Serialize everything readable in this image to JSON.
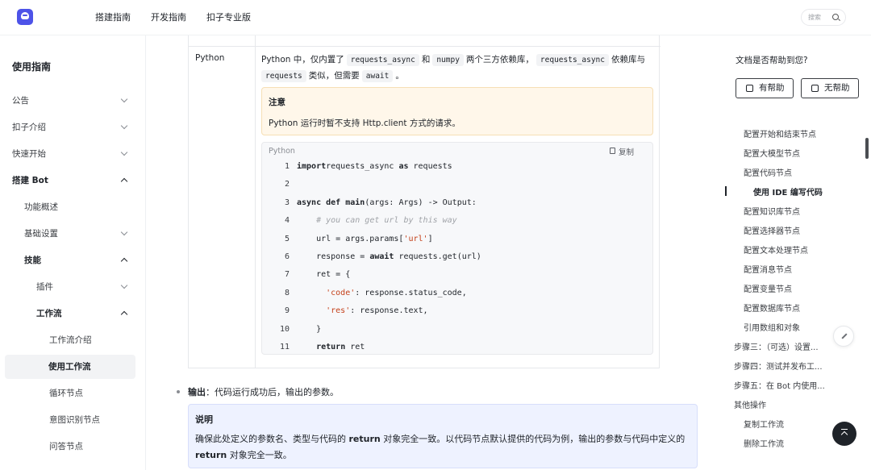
{
  "header": {
    "nav": [
      "搭建指南",
      "开发指南",
      "扣子专业版"
    ],
    "search_placeholder": "搜索"
  },
  "sidebar": {
    "title": "使用指南",
    "items": [
      {
        "label": "公告",
        "state": "collapsed"
      },
      {
        "label": "扣子介绍",
        "state": "collapsed"
      },
      {
        "label": "快速开始",
        "state": "collapsed"
      },
      {
        "label": "搭建 Bot",
        "state": "expanded"
      },
      {
        "label": "功能概述",
        "state": "none"
      },
      {
        "label": "基础设置",
        "state": "collapsed"
      },
      {
        "label": "技能",
        "state": "expanded"
      },
      {
        "label": "插件",
        "state": "collapsed"
      },
      {
        "label": "工作流",
        "state": "expanded"
      },
      {
        "label": "工作流介绍",
        "state": "none"
      },
      {
        "label": "使用工作流",
        "state": "active"
      },
      {
        "label": "循环节点",
        "state": "none"
      },
      {
        "label": "意图识别节点",
        "state": "none"
      },
      {
        "label": "问答节点",
        "state": "none"
      }
    ]
  },
  "main": {
    "language": "Python",
    "desc_prefix": "Python 中，仅内置了",
    "desc_code1": "requests_async",
    "desc_and": "和",
    "desc_code2": "numpy",
    "desc_mid": "两个三方依赖库，",
    "desc_code3": "requests_async",
    "desc_mid2": "依赖库与",
    "desc_code4": "requests",
    "desc_mid3": "类似，但需要",
    "desc_code5": "await",
    "desc_end": "。",
    "note_title": "注意",
    "note_text": "Python 运行时暂不支持 Http.client 方式的请求。",
    "code_lang": "Python",
    "copy_label": "复制",
    "code_lines": [
      {
        "n": "1",
        "segments": [
          [
            "kw",
            "import"
          ],
          [
            "",
            "requests_async "
          ],
          [
            "kw",
            "as"
          ],
          [
            "",
            " requests"
          ]
        ]
      },
      {
        "n": "2",
        "segments": []
      },
      {
        "n": "3",
        "segments": [
          [
            "kw",
            "async def"
          ],
          [
            "",
            " "
          ],
          [
            "kw",
            "main"
          ],
          [
            "",
            "(args: Args) -> Output:"
          ]
        ]
      },
      {
        "n": "4",
        "segments": [
          [
            "",
            "    "
          ],
          [
            "cm",
            "# you can get url by this way"
          ]
        ]
      },
      {
        "n": "5",
        "segments": [
          [
            "",
            "    url = args.params["
          ],
          [
            "str",
            "'url'"
          ],
          [
            "",
            "]"
          ]
        ]
      },
      {
        "n": "6",
        "segments": [
          [
            "",
            "    response = "
          ],
          [
            "kw",
            "await"
          ],
          [
            "",
            " requests.get(url)"
          ]
        ]
      },
      {
        "n": "7",
        "segments": [
          [
            "",
            "    ret = {"
          ]
        ]
      },
      {
        "n": "8",
        "segments": [
          [
            "",
            "      "
          ],
          [
            "str",
            "'code'"
          ],
          [
            "",
            ": response.status_code,"
          ]
        ]
      },
      {
        "n": "9",
        "segments": [
          [
            "",
            "      "
          ],
          [
            "str",
            "'res'"
          ],
          [
            "",
            ": response.text,"
          ]
        ]
      },
      {
        "n": "10",
        "segments": [
          [
            "",
            "    }"
          ]
        ]
      },
      {
        "n": "11",
        "segments": [
          [
            "",
            "    "
          ],
          [
            "kw",
            "return"
          ],
          [
            "",
            " ret"
          ]
        ]
      }
    ],
    "output_bold": "输出",
    "output_text": "：代码运行成功后，输出的参数。",
    "info_title": "说明",
    "info_text_1": "确保此处定义的参数名、类型与代码的 ",
    "info_bold_1": "return",
    "info_text_2": " 对象完全一致。以代码节点默认提供的代码为例，输出的参数与代码中定义的 ",
    "info_bold_2": "return",
    "info_text_3": " 对象完全一致。"
  },
  "right": {
    "helpful_question": "文档是否帮助到您?",
    "helpful_yes": "有帮助",
    "helpful_no": "无帮助",
    "toc": [
      {
        "label": "配置开始和结束节点",
        "level": 2
      },
      {
        "label": "配置大模型节点",
        "level": 2
      },
      {
        "label": "配置代码节点",
        "level": 2
      },
      {
        "label": "使用 IDE 编写代码",
        "level": 3,
        "active": true
      },
      {
        "label": "配置知识库节点",
        "level": 2
      },
      {
        "label": "配置选择器节点",
        "level": 2
      },
      {
        "label": "配置文本处理节点",
        "level": 2
      },
      {
        "label": "配置消息节点",
        "level": 2
      },
      {
        "label": "配置变量节点",
        "level": 2
      },
      {
        "label": "配置数据库节点",
        "level": 2
      },
      {
        "label": "引用数组和对象",
        "level": 2
      },
      {
        "label": "步骤三：（可选）设置...",
        "level": 1
      },
      {
        "label": "步骤四：测试并发布工...",
        "level": 1
      },
      {
        "label": "步骤五：在 Bot 内使用...",
        "level": 1
      },
      {
        "label": "其他操作",
        "level": 1
      },
      {
        "label": "复制工作流",
        "level": 2
      },
      {
        "label": "删除工作流",
        "level": 2
      }
    ]
  }
}
